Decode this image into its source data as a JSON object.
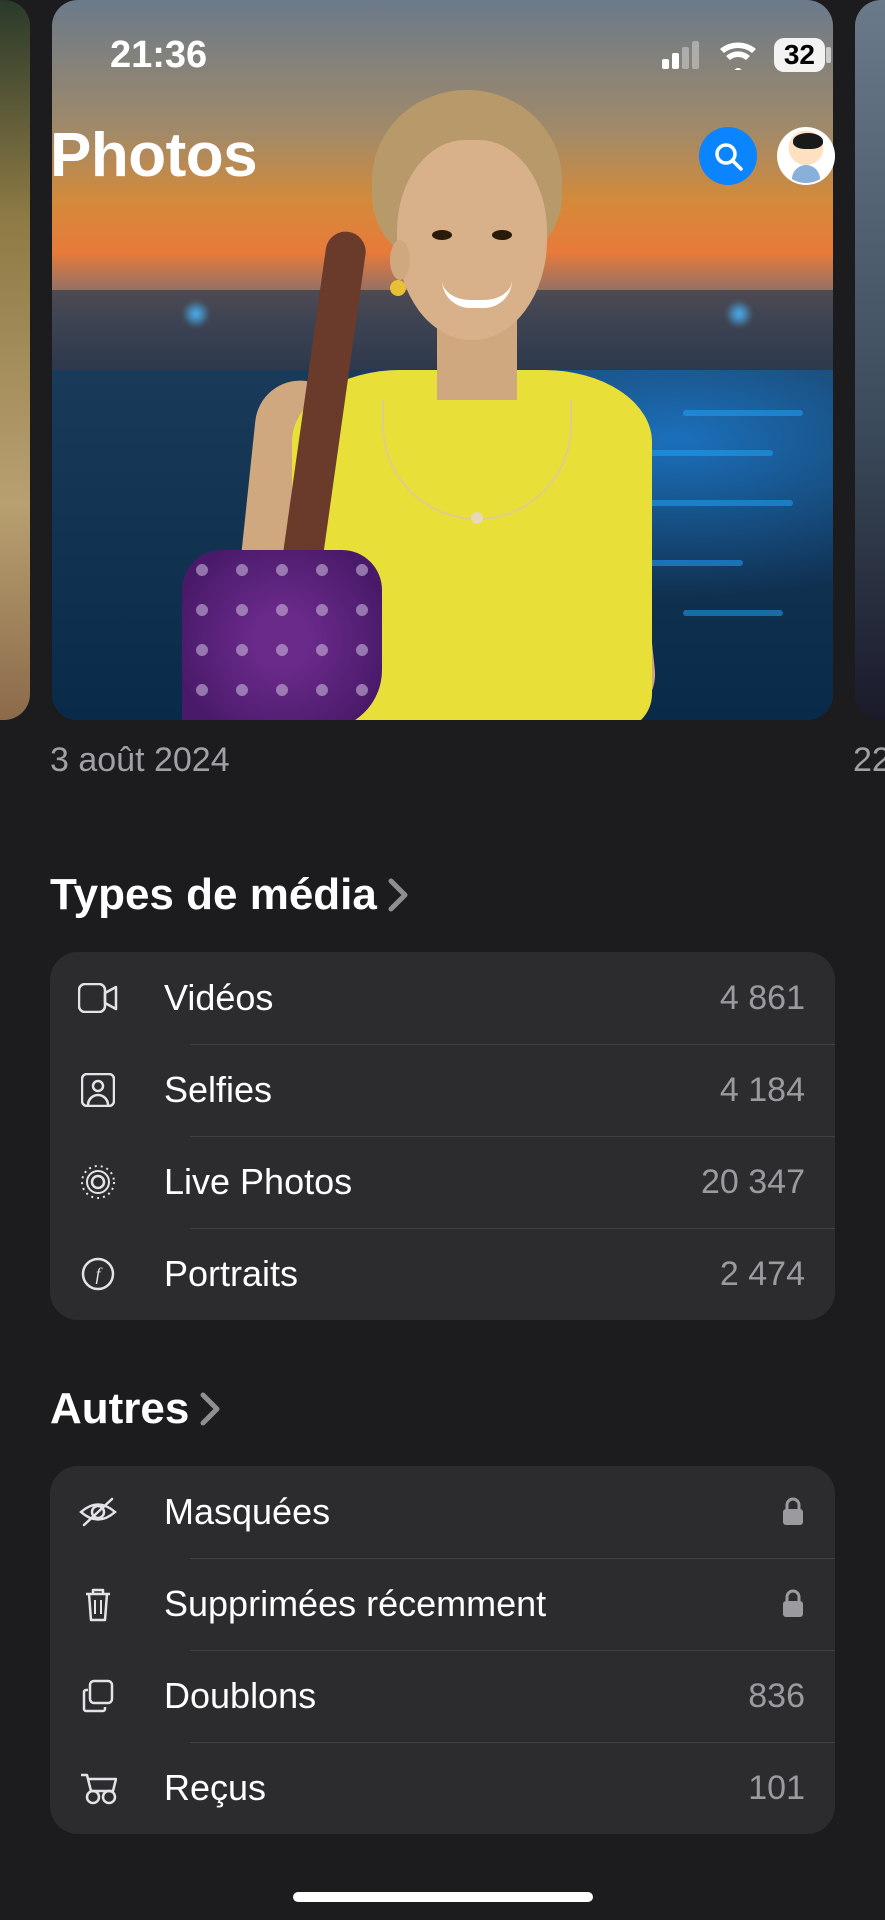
{
  "status": {
    "time": "21:36",
    "battery": "32"
  },
  "header": {
    "title": "Photos"
  },
  "hero": {
    "date": "3 août 2024",
    "next_date_partial": "22"
  },
  "sections": {
    "media": {
      "title": "Types de média",
      "items": [
        {
          "icon": "video",
          "label": "Vidéos",
          "count": "4 861"
        },
        {
          "icon": "selfie",
          "label": "Selfies",
          "count": "4 184"
        },
        {
          "icon": "live",
          "label": "Live Photos",
          "count": "20 347"
        },
        {
          "icon": "portrait",
          "label": "Portraits",
          "count": "2 474"
        }
      ]
    },
    "others": {
      "title": "Autres",
      "items": [
        {
          "icon": "hidden",
          "label": "Masquées",
          "locked": true
        },
        {
          "icon": "trash",
          "label": "Supprimées récemment",
          "locked": true
        },
        {
          "icon": "duplicate",
          "label": "Doublons",
          "count": "836"
        },
        {
          "icon": "receipt",
          "label": "Reçus",
          "count": "101"
        }
      ]
    }
  }
}
